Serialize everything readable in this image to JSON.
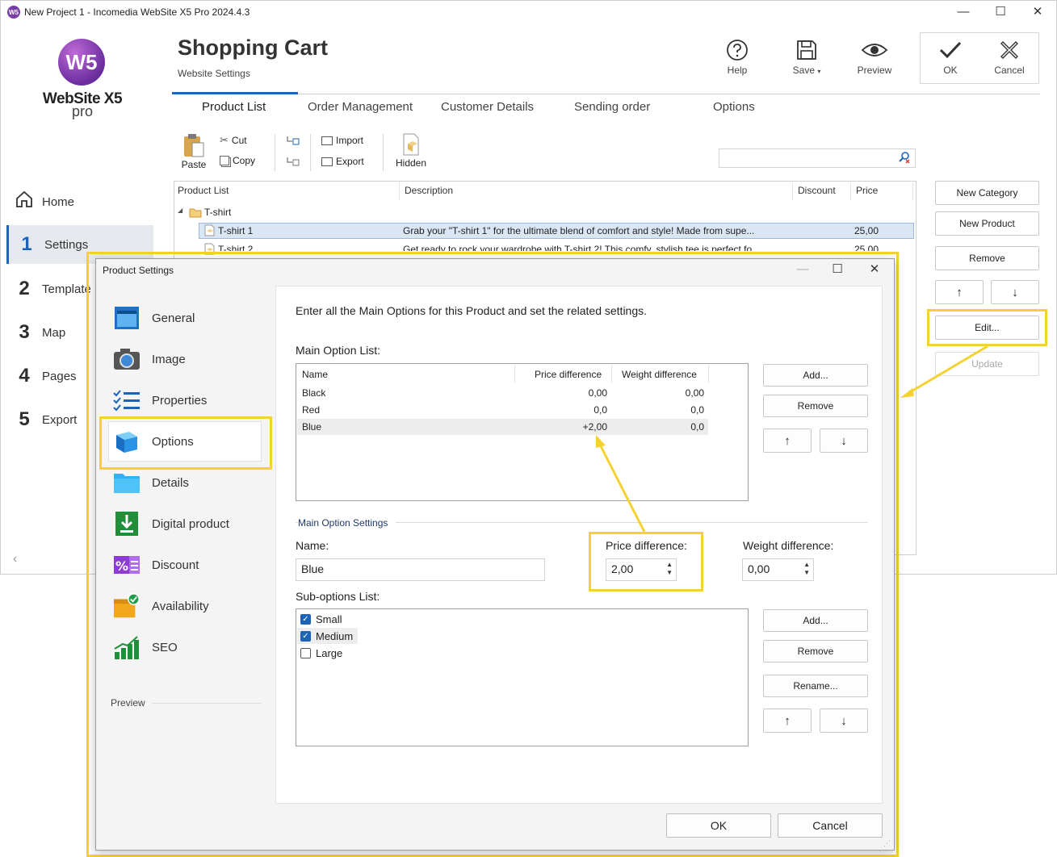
{
  "window": {
    "title": "New Project 1 - Incomedia WebSite X5 Pro 2024.4.3",
    "controls": [
      "—",
      "☐",
      "✕"
    ]
  },
  "logo": {
    "line1": "WebSite X5",
    "line2": "pro"
  },
  "sidebar": {
    "items": [
      {
        "num": "",
        "label": "Home"
      },
      {
        "num": "1",
        "label": "Settings"
      },
      {
        "num": "2",
        "label": "Template"
      },
      {
        "num": "3",
        "label": "Map"
      },
      {
        "num": "4",
        "label": "Pages"
      },
      {
        "num": "5",
        "label": "Export"
      }
    ],
    "collapse": "‹"
  },
  "header": {
    "title": "Shopping Cart",
    "subtitle": "Website Settings",
    "toolbar": {
      "help": "Help",
      "save": "Save",
      "save_caret": "▾",
      "preview": "Preview",
      "ok": "OK",
      "cancel": "Cancel"
    }
  },
  "tabs": [
    "Product List",
    "Order Management",
    "Customer Details",
    "Sending order",
    "Options"
  ],
  "tools": {
    "paste": "Paste",
    "cut": "Cut",
    "copy": "Copy",
    "import": "Import",
    "export": "Export",
    "hidden": "Hidden"
  },
  "product_table": {
    "columns": [
      "Product List",
      "Description",
      "Discount",
      "Price"
    ],
    "category": "T-shirt",
    "rows": [
      {
        "name": "T-shirt 1",
        "description": "Grab your \"T-shirt 1\" for the ultimate blend of comfort and style! Made from supe...",
        "discount": "",
        "price": "25,00"
      },
      {
        "name": "T-shirt 2",
        "description": "Get ready to rock your wardrobe with T-shirt 2! This comfy, stylish tee is perfect fo...",
        "discount": "",
        "price": "25,00"
      }
    ]
  },
  "right_buttons": {
    "new_category": "New Category",
    "new_product": "New Product",
    "remove": "Remove",
    "up": "↑",
    "down": "↓",
    "edit": "Edit...",
    "update": "Update"
  },
  "dialog": {
    "title": "Product Settings",
    "controls": [
      "—",
      "☐",
      "✕"
    ],
    "nav": [
      "General",
      "Image",
      "Properties",
      "Options",
      "Details",
      "Digital product",
      "Discount",
      "Availability",
      "SEO"
    ],
    "preview_label": "Preview",
    "intro": "Enter all the Main Options for this Product and set the related settings.",
    "main_option_list_label": "Main Option List:",
    "main_options": {
      "columns": [
        "Name",
        "Price difference",
        "Weight difference"
      ],
      "rows": [
        {
          "name": "Black",
          "price": "0,00",
          "weight": "0,00"
        },
        {
          "name": "Red",
          "price": "0,0",
          "weight": "0,0"
        },
        {
          "name": "Blue",
          "price": "+2,00",
          "weight": "0,0"
        }
      ]
    },
    "main_buttons": {
      "add": "Add...",
      "remove": "Remove",
      "up": "↑",
      "down": "↓"
    },
    "settings_group": "Main Option Settings",
    "name_label": "Name:",
    "name_value": "Blue",
    "price_label": "Price difference:",
    "price_value": "2,00",
    "weight_label": "Weight difference:",
    "weight_value": "0,00",
    "sub_list_label": "Sub-options List:",
    "sub_options": [
      {
        "label": "Small",
        "checked": true
      },
      {
        "label": "Medium",
        "checked": true
      },
      {
        "label": "Large",
        "checked": false
      }
    ],
    "sub_buttons": {
      "add": "Add...",
      "remove": "Remove",
      "rename": "Rename...",
      "up": "↑",
      "down": "↓"
    },
    "ok": "OK",
    "cancel": "Cancel"
  },
  "colors": {
    "accent": "#1d63b8",
    "highlight": "#f5d233",
    "selection": "#dbe6f4"
  }
}
